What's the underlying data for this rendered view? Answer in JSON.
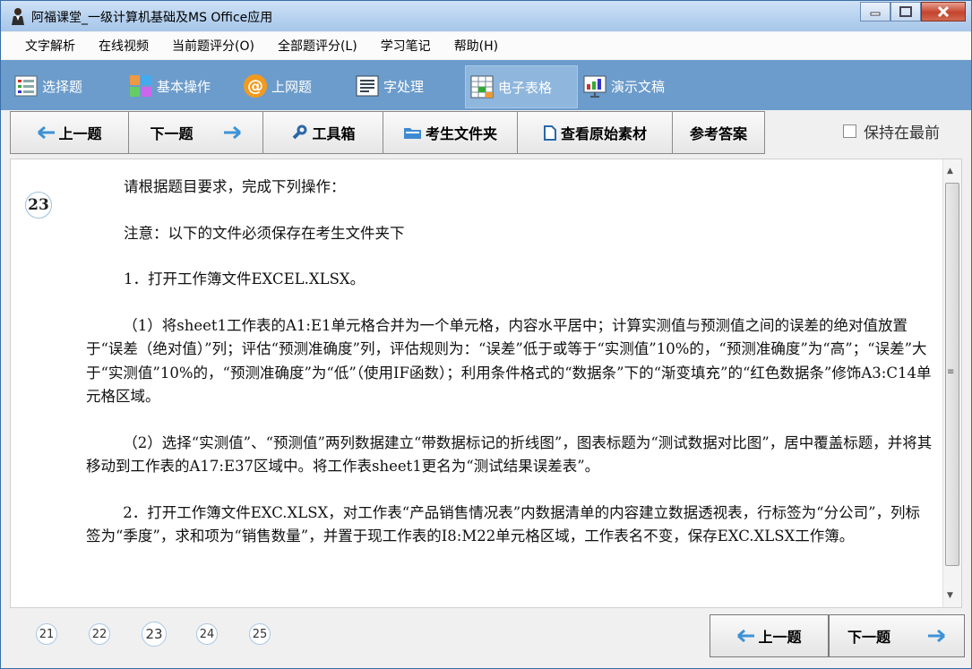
{
  "window": {
    "title": "阿福课堂_一级计算机基础及MS Office应用"
  },
  "menu": [
    "文字解析",
    "在线视频",
    "当前题评分(O)",
    "全部题评分(L)",
    "学习笔记",
    "帮助(H)"
  ],
  "categories": [
    {
      "label": "选择题",
      "icon": "list-icon"
    },
    {
      "label": "基本操作",
      "icon": "grid-icon"
    },
    {
      "label": "上网题",
      "icon": "at-icon"
    },
    {
      "label": "字处理",
      "icon": "document-icon"
    },
    {
      "label": "电子表格",
      "icon": "spreadsheet-icon",
      "active": true
    },
    {
      "label": "演示文稿",
      "icon": "presentation-icon"
    }
  ],
  "nav": {
    "prev": "上一题",
    "next": "下一题",
    "toolbox": "工具箱",
    "folder": "考生文件夹",
    "material": "查看原始素材",
    "answer": "参考答案",
    "keep_on_top": "保持在最前"
  },
  "question": {
    "number": "23",
    "lines": [
      "请根据题目要求，完成下列操作：",
      "注意：以下的文件必须保存在考生文件夹下",
      "1．打开工作簿文件EXCEL.XLSX。",
      "（1）将sheet1工作表的A1:E1单元格合并为一个单元格，内容水平居中；计算实测值与预测值之间的误差的绝对值放置于“误差（绝对值）”列；评估“预测准确度”列，评估规则为：“误差”低于或等于“实测值”10%的，“预测准确度”为“高”；“误差”大于“实测值”10%的，“预测准确度”为“低”（使用IF函数）；利用条件格式的“数据条”下的“渐变填充”的“红色数据条”修饰A3:C14单元格区域。",
      "（2）选择“实测值”、“预测值”两列数据建立“带数据标记的折线图”，图表标题为“测试数据对比图”，居中覆盖标题，并将其移动到工作表的A17:E37区域中。将工作表sheet1更名为“测试结果误差表”。",
      "2．打开工作簿文件EXC.XLSX，对工作表“产品销售情况表”内数据清单的内容建立数据透视表，行标签为“分公司”，列标签为“季度”，求和项为“销售数量”，并置于现工作表的I8:M22单元格区域，工作表名不变，保存EXC.XLSX工作簿。"
    ]
  },
  "pages": [
    "21",
    "22",
    "23",
    "24",
    "25"
  ],
  "current_page": "23",
  "footer": {
    "prev": "上一题",
    "next": "下一题"
  },
  "colors": {
    "toolbar_bg": "#6c9ccb",
    "arrow_blue": "#3d92d6"
  }
}
